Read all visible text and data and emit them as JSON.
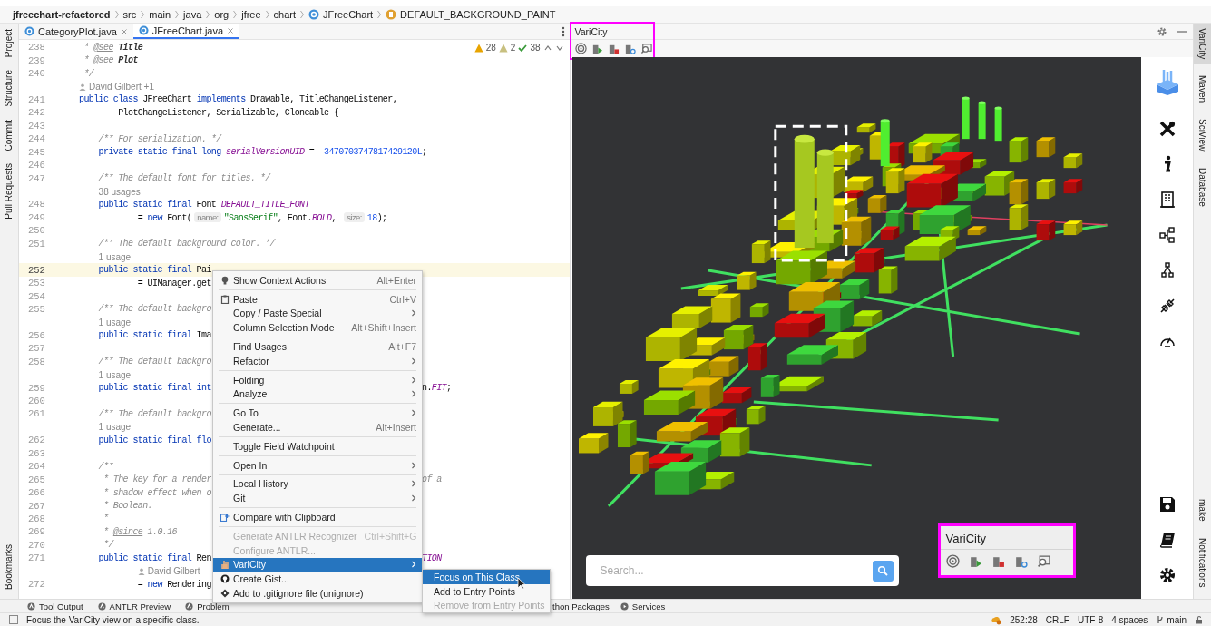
{
  "breadcrumb": [
    "jfreechart-refactored",
    "src",
    "main",
    "java",
    "org",
    "jfree",
    "chart",
    "JFreeChart",
    "DEFAULT_BACKGROUND_PAINT"
  ],
  "left_strip": {
    "top": [
      "Project",
      "Structure",
      "Commit",
      "Pull Requests"
    ],
    "bottom": [
      "Bookmarks"
    ]
  },
  "editor": {
    "tabs": [
      {
        "label": "CategoryPlot.java",
        "selected": false
      },
      {
        "label": "JFreeChart.java",
        "selected": true
      }
    ],
    "inspections": {
      "warnings": "28",
      "weak_warnings": "2",
      "passed": "38"
    },
    "lines": [
      {
        "kind": "code",
        "number": "238",
        "current": false,
        "tokens": [
          {
            "kind": "cm",
            "text": " * "
          },
          {
            "kind": "tag",
            "text": "@see"
          },
          {
            "kind": "doc",
            "text": " Title"
          }
        ]
      },
      {
        "kind": "code",
        "number": "239",
        "current": false,
        "tokens": [
          {
            "kind": "cm",
            "text": " * "
          },
          {
            "kind": "tag",
            "text": "@see"
          },
          {
            "kind": "doc",
            "text": " Plot"
          }
        ]
      },
      {
        "kind": "code",
        "number": "240",
        "current": false,
        "tokens": [
          {
            "kind": "cm",
            "text": " */"
          }
        ]
      },
      {
        "kind": "author",
        "text": "David Gilbert +1"
      },
      {
        "kind": "code",
        "number": "241",
        "current": false,
        "tokens": [
          {
            "kind": "kw",
            "text": "public class "
          },
          {
            "kind": "pl",
            "text": "JFreeChart "
          },
          {
            "kind": "kw",
            "text": "implements "
          },
          {
            "kind": "pl",
            "text": "Drawable, TitleChangeListener,"
          }
        ]
      },
      {
        "kind": "code",
        "number": "242",
        "current": false,
        "tokens": [
          {
            "kind": "pl",
            "text": "        PlotChangeListener, Serializable, Cloneable {"
          }
        ]
      },
      {
        "kind": "code",
        "number": "243",
        "current": false
      },
      {
        "kind": "code",
        "number": "244",
        "current": false,
        "tokens": [
          {
            "kind": "cm",
            "text": "    /** For serialization. */"
          }
        ]
      },
      {
        "kind": "code",
        "number": "245",
        "current": false,
        "tokens": [
          {
            "kind": "kw",
            "text": "    private static final long "
          },
          {
            "kind": "ct",
            "text": "serialVersionUID"
          },
          {
            "kind": "pl",
            "text": " = "
          },
          {
            "kind": "num",
            "text": "-3470703747817429120L"
          },
          {
            "kind": "pl",
            "text": ";"
          }
        ]
      },
      {
        "kind": "code",
        "number": "246",
        "current": false
      },
      {
        "kind": "code",
        "number": "247",
        "current": false,
        "tokens": [
          {
            "kind": "cm",
            "text": "    /** The default font for titles. */"
          }
        ]
      },
      {
        "kind": "usages",
        "text": "38 usages"
      },
      {
        "kind": "code",
        "number": "248",
        "current": false,
        "tokens": [
          {
            "kind": "kw",
            "text": "    public static final "
          },
          {
            "kind": "pl",
            "text": "Font "
          },
          {
            "kind": "ct",
            "text": "DEFAULT_TITLE_FONT"
          }
        ]
      },
      {
        "kind": "code",
        "number": "249",
        "current": false,
        "tokens": [
          {
            "kind": "pl",
            "text": "            = "
          },
          {
            "kind": "kw",
            "text": "new "
          },
          {
            "kind": "pl",
            "text": "Font("
          },
          {
            "kind": "hint",
            "text": "name:"
          },
          {
            "kind": "str",
            "text": "\"SansSerif\""
          },
          {
            "kind": "pl",
            "text": ", Font."
          },
          {
            "kind": "ct",
            "text": "BOLD"
          },
          {
            "kind": "pl",
            "text": ", "
          },
          {
            "kind": "hint",
            "text": "size:"
          },
          {
            "kind": "num",
            "text": "18"
          },
          {
            "kind": "pl",
            "text": ");"
          }
        ]
      },
      {
        "kind": "code",
        "number": "250",
        "current": false
      },
      {
        "kind": "code",
        "number": "251",
        "current": false,
        "tokens": [
          {
            "kind": "cm",
            "text": "    /** The default background color. */"
          }
        ]
      },
      {
        "kind": "usages",
        "text": "1 usage"
      },
      {
        "kind": "code",
        "number": "252",
        "current": true,
        "tokens": [
          {
            "kind": "kw",
            "text": "    public static final "
          },
          {
            "kind": "pl",
            "text": "Pai"
          }
        ]
      },
      {
        "kind": "code",
        "number": "253",
        "current": false,
        "tokens": [
          {
            "kind": "pl",
            "text": "            = UIManager.get"
          }
        ]
      },
      {
        "kind": "code",
        "number": "254",
        "current": false
      },
      {
        "kind": "code",
        "number": "255",
        "current": false,
        "tokens": [
          {
            "kind": "cm",
            "text": "    /** The default backgro"
          }
        ]
      },
      {
        "kind": "usages",
        "text": "1 usage"
      },
      {
        "kind": "code",
        "number": "256",
        "current": false,
        "tokens": [
          {
            "kind": "kw",
            "text": "    public static final "
          },
          {
            "kind": "pl",
            "text": "Ima"
          }
        ]
      },
      {
        "kind": "code",
        "number": "257",
        "current": false
      },
      {
        "kind": "code",
        "number": "258",
        "current": false,
        "tokens": [
          {
            "kind": "cm",
            "text": "    /** The default backgro"
          }
        ]
      },
      {
        "kind": "usages",
        "text": "1 usage"
      },
      {
        "kind": "code",
        "number": "259",
        "current": false,
        "tokens": [
          {
            "kind": "kw",
            "text": "    public static final "
          },
          {
            "kind": "kw",
            "text": "int"
          }
        ],
        "tail": [
          {
            "kind": "pl",
            "text": "n."
          },
          {
            "kind": "ct",
            "text": "FIT"
          },
          {
            "kind": "pl",
            "text": ";"
          }
        ]
      },
      {
        "kind": "code",
        "number": "260",
        "current": false
      },
      {
        "kind": "code",
        "number": "261",
        "current": false,
        "tokens": [
          {
            "kind": "cm",
            "text": "    /** The default backgro"
          }
        ]
      },
      {
        "kind": "usages",
        "text": "1 usage"
      },
      {
        "kind": "code",
        "number": "262",
        "current": false,
        "tokens": [
          {
            "kind": "kw",
            "text": "    public static final "
          },
          {
            "kind": "kw",
            "text": "flo"
          }
        ]
      },
      {
        "kind": "code",
        "number": "263",
        "current": false
      },
      {
        "kind": "code",
        "number": "264",
        "current": false,
        "tokens": [
          {
            "kind": "cm",
            "text": "    /**"
          }
        ]
      },
      {
        "kind": "code",
        "number": "265",
        "current": false,
        "tokens": [
          {
            "kind": "cm",
            "text": "     * The key for a render"
          }
        ],
        "tail": [
          {
            "kind": "cm",
            "text": "of a"
          }
        ]
      },
      {
        "kind": "code",
        "number": "266",
        "current": false,
        "tokens": [
          {
            "kind": "cm",
            "text": "     * shadow effect when o"
          }
        ]
      },
      {
        "kind": "code",
        "number": "267",
        "current": false,
        "tokens": [
          {
            "kind": "cm",
            "text": "     * Boolean."
          }
        ]
      },
      {
        "kind": "code",
        "number": "268",
        "current": false,
        "tokens": [
          {
            "kind": "cm",
            "text": "     *"
          }
        ]
      },
      {
        "kind": "code",
        "number": "269",
        "current": false,
        "tokens": [
          {
            "kind": "cm",
            "text": "     * "
          },
          {
            "kind": "tag",
            "text": "@since"
          },
          {
            "kind": "cm",
            "text": " 1.0.16"
          }
        ]
      },
      {
        "kind": "code",
        "number": "270",
        "current": false,
        "tokens": [
          {
            "kind": "cm",
            "text": "     */"
          }
        ]
      },
      {
        "kind": "code",
        "number": "271",
        "current": false,
        "tokens": [
          {
            "kind": "kw",
            "text": "    public static final "
          },
          {
            "kind": "pl",
            "text": "Ren"
          }
        ],
        "tail": [
          {
            "kind": "ct",
            "text": "TION"
          }
        ]
      },
      {
        "kind": "author",
        "text": "David Gilbert"
      },
      {
        "kind": "code",
        "number": "272",
        "current": false,
        "tokens": [
          {
            "kind": "pl",
            "text": "            = "
          },
          {
            "kind": "kw",
            "text": "new "
          },
          {
            "kind": "pl",
            "text": "Rendering"
          }
        ]
      }
    ]
  },
  "context_menu": {
    "groups": [
      {
        "items": [
          {
            "label": "Show Context Actions",
            "shortcut": "Alt+Enter",
            "submenu": false,
            "disabled": false,
            "selected": false
          }
        ]
      },
      {
        "items": [
          {
            "label": "Paste",
            "shortcut": "Ctrl+V",
            "submenu": false,
            "disabled": false,
            "selected": false
          },
          {
            "label": "Copy / Paste Special",
            "submenu": true,
            "disabled": false,
            "selected": false
          },
          {
            "label": "Column Selection Mode",
            "shortcut": "Alt+Shift+Insert",
            "submenu": false,
            "disabled": false,
            "selected": false
          }
        ]
      },
      {
        "items": [
          {
            "label": "Find Usages",
            "shortcut": "Alt+F7",
            "submenu": false,
            "disabled": false,
            "selected": false
          },
          {
            "label": "Refactor",
            "submenu": true,
            "disabled": false,
            "selected": false
          }
        ]
      },
      {
        "items": [
          {
            "label": "Folding",
            "submenu": true,
            "disabled": false,
            "selected": false
          },
          {
            "label": "Analyze",
            "submenu": true,
            "disabled": false,
            "selected": false
          }
        ]
      },
      {
        "items": [
          {
            "label": "Go To",
            "submenu": true,
            "disabled": false,
            "selected": false
          },
          {
            "label": "Generate...",
            "shortcut": "Alt+Insert",
            "submenu": false,
            "disabled": false,
            "selected": false
          }
        ]
      },
      {
        "items": [
          {
            "label": "Toggle Field Watchpoint",
            "submenu": false,
            "disabled": false,
            "selected": false
          }
        ]
      },
      {
        "items": [
          {
            "label": "Open In",
            "submenu": true,
            "disabled": false,
            "selected": false
          }
        ]
      },
      {
        "items": [
          {
            "label": "Local History",
            "submenu": true,
            "disabled": false,
            "selected": false
          },
          {
            "label": "Git",
            "submenu": true,
            "disabled": false,
            "selected": false
          }
        ]
      },
      {
        "items": [
          {
            "label": "Compare with Clipboard",
            "submenu": false,
            "disabled": false,
            "selected": false
          }
        ]
      },
      {
        "items": [
          {
            "label": "Generate ANTLR Recognizer",
            "shortcut": "Ctrl+Shift+G",
            "submenu": false,
            "disabled": true,
            "selected": false
          },
          {
            "label": "Configure ANTLR...",
            "submenu": false,
            "disabled": true,
            "selected": false
          },
          {
            "label": "VariCity",
            "submenu": true,
            "disabled": false,
            "selected": true
          },
          {
            "label": "Create Gist...",
            "submenu": false,
            "disabled": false,
            "selected": false
          },
          {
            "label": "Add to .gitignore file (unignore)",
            "submenu": false,
            "disabled": false,
            "selected": false
          }
        ]
      }
    ]
  },
  "submenu": [
    {
      "label": "Focus on This Class",
      "disabled": false,
      "selected": true
    },
    {
      "label": "Add to Entry Points",
      "disabled": false,
      "selected": false
    },
    {
      "label": "Remove from Entry Points",
      "disabled": true,
      "selected": false
    }
  ],
  "varicity": {
    "title": "VariCity",
    "search": {
      "placeholder": "Search..."
    },
    "floating_panel": {
      "title": "VariCity"
    }
  },
  "right_strip": {
    "top": [
      {
        "label": "VariCity",
        "selected": true
      },
      {
        "label": "Maven",
        "selected": false
      },
      {
        "label": "SciView",
        "selected": false
      },
      {
        "label": "Database",
        "selected": false
      }
    ],
    "bottom": [
      "make",
      "Notifications"
    ]
  },
  "bottom_bar": {
    "left": [
      "Tool Output",
      "ANTLR Preview",
      "Problem"
    ],
    "right": [
      "thon Packages",
      "Services"
    ]
  },
  "status_bar": {
    "message": "Focus the VariCity view on a specific class.",
    "position": "252:28",
    "line_separator": "CRLF",
    "encoding": "UTF-8",
    "indent": "4 spaces",
    "branch": "main"
  }
}
